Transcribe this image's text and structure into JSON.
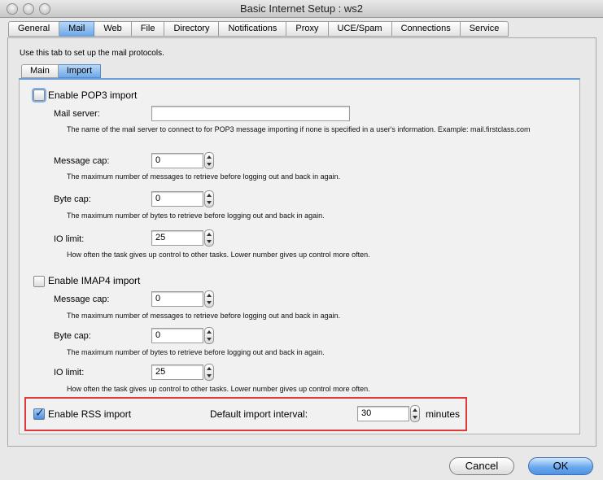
{
  "window": {
    "title": "Basic Internet Setup : ws2"
  },
  "tabs": [
    {
      "label": "General"
    },
    {
      "label": "Mail",
      "active": true
    },
    {
      "label": "Web"
    },
    {
      "label": "File"
    },
    {
      "label": "Directory"
    },
    {
      "label": "Notifications"
    },
    {
      "label": "Proxy"
    },
    {
      "label": "UCE/Spam"
    },
    {
      "label": "Connections"
    },
    {
      "label": "Service"
    }
  ],
  "intro": "Use this tab to set up the mail protocols.",
  "subtabs": [
    {
      "label": "Main"
    },
    {
      "label": "Import",
      "active": true
    }
  ],
  "pop3": {
    "enable_label": "Enable POP3 import",
    "checked": false,
    "mail_server_label": "Mail server:",
    "mail_server_value": "",
    "mail_server_help": "The name of the mail server to connect to for POP3 message importing if none is specified in a user's information. Example: mail.firstclass.com",
    "message_cap_label": "Message cap:",
    "message_cap_value": "0",
    "message_cap_help": "The maximum number of messages to retrieve before logging out and back in again.",
    "byte_cap_label": "Byte cap:",
    "byte_cap_value": "0",
    "byte_cap_help": "The maximum number of bytes to retrieve before logging out and back in again.",
    "io_limit_label": "IO limit:",
    "io_limit_value": "25",
    "io_limit_help": "How often the task gives up control to other tasks. Lower number gives up control more often."
  },
  "imap4": {
    "enable_label": "Enable IMAP4 import",
    "checked": false,
    "message_cap_label": "Message cap:",
    "message_cap_value": "0",
    "message_cap_help": "The maximum number of messages to retrieve before logging out and back in again.",
    "byte_cap_label": "Byte cap:",
    "byte_cap_value": "0",
    "byte_cap_help": "The maximum number of bytes to retrieve before logging out and back in again.",
    "io_limit_label": "IO limit:",
    "io_limit_value": "25",
    "io_limit_help": "How often the task gives up control to other tasks. Lower number gives up control more often."
  },
  "rss": {
    "enable_label": "Enable RSS import",
    "checked": true,
    "interval_label": "Default import interval:",
    "interval_value": "30",
    "interval_unit": "minutes"
  },
  "buttons": {
    "cancel": "Cancel",
    "ok": "OK"
  },
  "colors": {
    "accent": "#6da8e8",
    "highlight_box": "#e0393a"
  }
}
